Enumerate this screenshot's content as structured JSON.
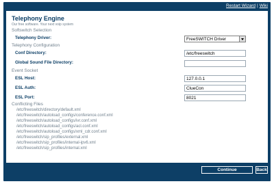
{
  "header": {
    "restart_wizard": "Restart Wizard",
    "separator": "|",
    "wiki": "Wiki"
  },
  "app": {
    "title": "Telephony Engine",
    "tagline": "Our free software. Your next voip system"
  },
  "sections": {
    "softswitch": "Softswitch Selection",
    "telephony": "Telephony Configuration",
    "event_socket": "Event Socket",
    "conflicting": "Conflicting Files"
  },
  "fields": {
    "telephony_driver": {
      "label": "Telephony Driver:",
      "value": "FreeSWITCH Driver"
    },
    "conf_directory": {
      "label": "Conf Directory:",
      "value": "/etc/freeswitch"
    },
    "global_sound_dir": {
      "label": "Global Sound File Directory:",
      "value": ""
    },
    "esl_host": {
      "label": "ESL Host:",
      "value": "127.0.0.1"
    },
    "esl_auth": {
      "label": "ESL Auth:",
      "value": "ClueCon"
    },
    "esl_port": {
      "label": "ESL Port:",
      "value": "8021"
    }
  },
  "conflicting_files": [
    "/etc/freeswitch/directory/default.xml",
    "/etc/freeswitch/autoload_configs/conference.conf.xml",
    "/etc/freeswitch/autoload_configs/ivr.conf.xml",
    "/etc/freeswitch/autoload_configs/acl.conf.xml",
    "/etc/freeswitch/autoload_configs/xml_cdr.conf.xml",
    "/etc/freeswitch/sip_profiles/external.xml",
    "/etc/freeswitch/sip_profiles/internal-ipv6.xml",
    "/etc/freeswitch/sip_profiles/internal.xml"
  ],
  "buttons": {
    "continue": "Continue",
    "back": "Back"
  },
  "colors": {
    "frame": "#0d3f66",
    "label": "#0d3f66",
    "muted": "#6f7f8c"
  },
  "icons": {
    "dropdown": "chevron-down-icon"
  }
}
